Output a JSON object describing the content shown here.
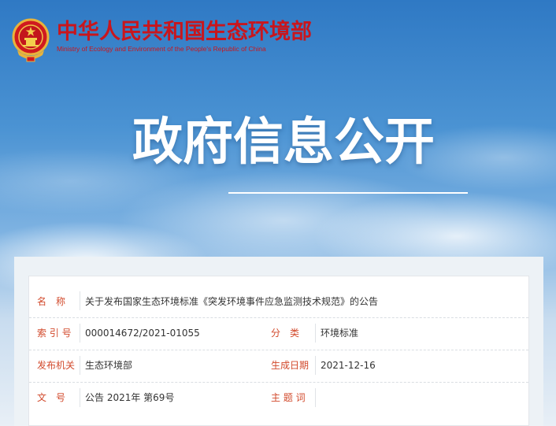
{
  "header": {
    "org_name_cn": "中华人民共和国生态环境部",
    "org_name_en": "Ministry of Ecology and Environment of the People's Republic of China",
    "emblem_icon": "national-emblem-icon"
  },
  "hero": {
    "title": "政府信息公开"
  },
  "info": {
    "name_label": "名　称",
    "name_value": "关于发布国家生态环境标准《突发环境事件应急监测技术规范》的公告",
    "index_label": "索 引 号",
    "index_value": "000014672/2021-01055",
    "category_label": "分　类",
    "category_value": "环境标准",
    "issuer_label": "发布机关",
    "issuer_value": "生态环境部",
    "date_label": "生成日期",
    "date_value": "2021-12-16",
    "docno_label": "文　号",
    "docno_value": "公告 2021年 第69号",
    "subject_label": "主 题 词",
    "subject_value": ""
  },
  "colors": {
    "brand_red": "#c8161d",
    "label_red": "#d24a2c",
    "sky_blue": "#4b93d3"
  }
}
